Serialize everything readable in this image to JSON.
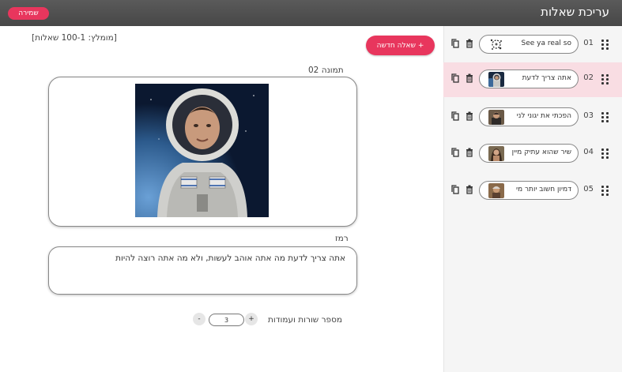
{
  "header": {
    "title": "עריכת שאלות",
    "save_label": "שמירה"
  },
  "main": {
    "hint": "[מומלץ: 100-1 שאלות]",
    "new_question_label": "+ שאלה חדשה",
    "image_label": "תמונה 02",
    "hint_field_label": "רמז",
    "hint_field_value": "אתה צריך לדעת מה אתה אוהב לעשות, ולא מה אתה רוצה להיות",
    "rows_cols_label": "מספר שורות ועמודות",
    "stepper": {
      "value": "3",
      "plus": "+",
      "minus": "-"
    }
  },
  "sidebar": {
    "items": [
      {
        "num": "01",
        "text": "See ya real so",
        "thumb": "splash"
      },
      {
        "num": "02",
        "text": "אתה צריך לדעת",
        "thumb": "astronaut",
        "active": true
      },
      {
        "num": "03",
        "text": "הפכתי את יגוני לני",
        "thumb": "man"
      },
      {
        "num": "04",
        "text": "שיר שהוא עתיק מיין",
        "thumb": "woman"
      },
      {
        "num": "05",
        "text": "דמיון חשוב יותר מי",
        "thumb": "portrait"
      }
    ]
  },
  "colors": {
    "accent": "#e8365d",
    "active_row": "#f9dde3",
    "topbar": "#4f4f4f"
  }
}
